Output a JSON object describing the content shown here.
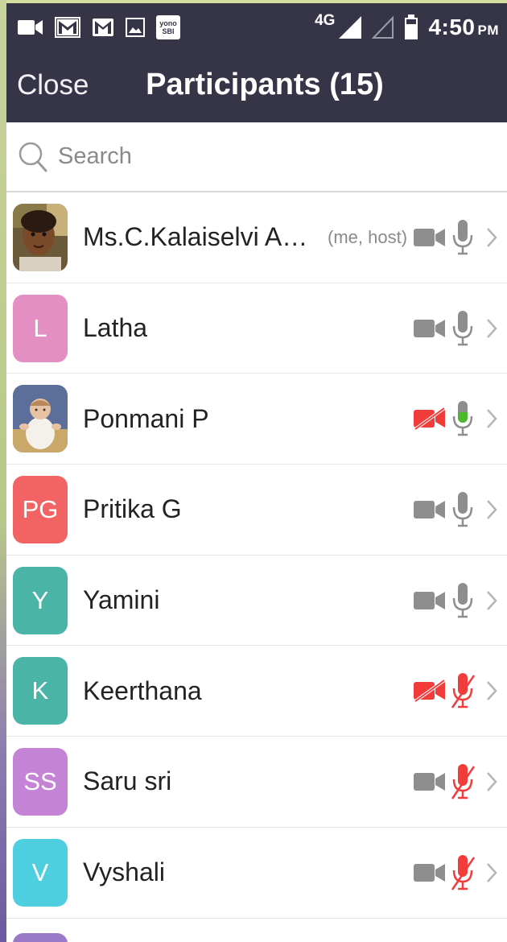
{
  "status_bar": {
    "network": "4G",
    "time": "4:50",
    "ampm": "PM",
    "yono_top": "yono",
    "yono_bottom": "SBI"
  },
  "header": {
    "close_label": "Close",
    "title": "Participants (15)"
  },
  "search": {
    "placeholder": "Search"
  },
  "participants": [
    {
      "name": "Ms.C.Kalaiselvi ASS...",
      "tag": "(me, host)",
      "avatar": "photo-child",
      "camera": "off-gray",
      "mic": "gray"
    },
    {
      "name": "Latha",
      "initials": "L",
      "avatar_color": "#e38fc4",
      "camera": "off-gray",
      "mic": "gray"
    },
    {
      "name": "Ponmani P",
      "avatar": "photo-baby",
      "camera": "red-muted",
      "mic": "green"
    },
    {
      "name": "Pritika G",
      "initials": "PG",
      "avatar_color": "#f26464",
      "camera": "off-gray",
      "mic": "gray"
    },
    {
      "name": "Yamini",
      "initials": "Y",
      "avatar_color": "#4ab4a6",
      "camera": "off-gray",
      "mic": "gray"
    },
    {
      "name": "Keerthana",
      "initials": "K",
      "avatar_color": "#4ab4a6",
      "camera": "red-muted",
      "mic": "red-muted"
    },
    {
      "name": "Saru sri",
      "initials": "SS",
      "avatar_color": "#c583d6",
      "camera": "off-gray",
      "mic": "red-muted"
    },
    {
      "name": "Vyshali",
      "initials": "V",
      "avatar_color": "#4ecfe0",
      "camera": "off-gray",
      "mic": "red-muted"
    }
  ],
  "colors": {
    "header_bg": "#363548",
    "icon_gray": "#8e8e8e",
    "muted_red": "#f23c3c",
    "mic_green": "#4cb82e"
  }
}
